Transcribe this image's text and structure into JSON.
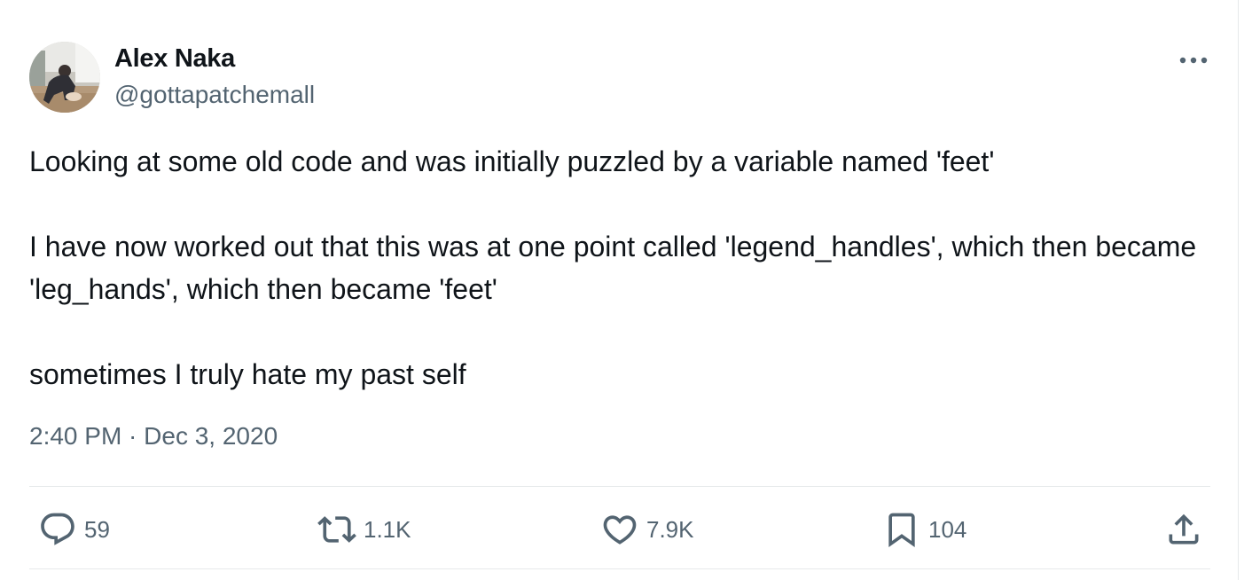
{
  "author": {
    "display_name": "Alex Naka",
    "handle": "@gottapatchemall"
  },
  "tweet": {
    "paragraphs": [
      "Looking at some old code and was initially puzzled by a variable named 'feet'",
      "I have now worked out that this was at one point called 'legend_handles', which then became 'leg_hands', which then became 'feet'",
      "sometimes I truly hate my past self"
    ],
    "timestamp": "2:40 PM · Dec 3, 2020"
  },
  "actions": {
    "replies": "59",
    "retweets": "1.1K",
    "likes": "7.9K",
    "bookmarks": "104"
  },
  "icons": {
    "more": "more-horizontal-icon",
    "reply": "reply-icon",
    "retweet": "retweet-icon",
    "like": "heart-icon",
    "bookmark": "bookmark-icon",
    "share": "share-icon"
  },
  "colors": {
    "text": "#0f1419",
    "secondary": "#536471",
    "divider": "#e6e9eb"
  }
}
